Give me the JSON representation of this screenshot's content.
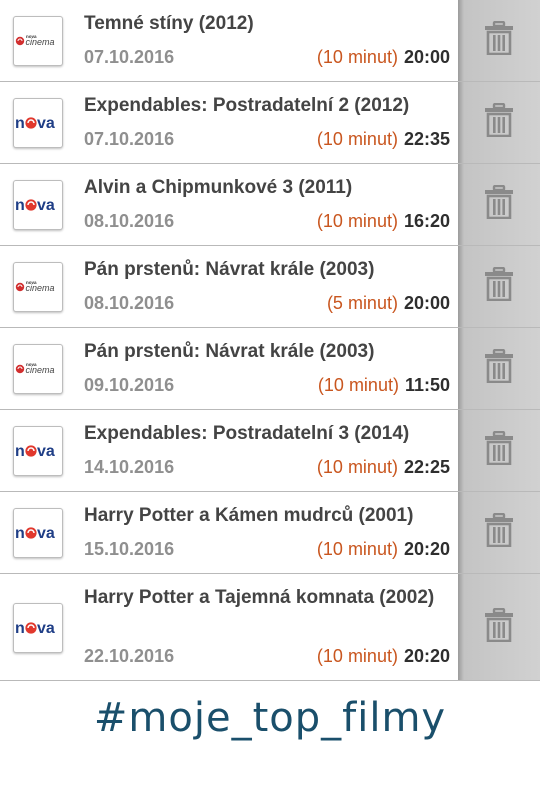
{
  "programs": [
    {
      "channel": "nova cinema",
      "title": "Temné stíny (2012)",
      "date": "07.10.2016",
      "reminder": "(10 minut)",
      "time": "20:00"
    },
    {
      "channel": "nova",
      "title": "Expendables: Postradatelní 2 (2012)",
      "date": "07.10.2016",
      "reminder": "(10 minut)",
      "time": "22:35"
    },
    {
      "channel": "nova",
      "title": "Alvin a Chipmunkové 3 (2011)",
      "date": "08.10.2016",
      "reminder": "(10 minut)",
      "time": "16:20"
    },
    {
      "channel": "nova cinema",
      "title": "Pán prstenů: Návrat krále (2003)",
      "date": "08.10.2016",
      "reminder": "(5 minut)",
      "time": "20:00"
    },
    {
      "channel": "nova cinema",
      "title": "Pán prstenů: Návrat krále (2003)",
      "date": "09.10.2016",
      "reminder": "(10 minut)",
      "time": "11:50"
    },
    {
      "channel": "nova",
      "title": "Expendables: Postradatelní 3 (2014)",
      "date": "14.10.2016",
      "reminder": "(10 minut)",
      "time": "22:25"
    },
    {
      "channel": "nova",
      "title": "Harry Potter a Kámen mudrců (2001)",
      "date": "15.10.2016",
      "reminder": "(10 minut)",
      "time": "20:20"
    },
    {
      "channel": "nova",
      "title": "Harry Potter a Tajemná komnata (2002)",
      "date": "22.10.2016",
      "reminder": "(10 minut)",
      "time": "20:20"
    }
  ],
  "hashtag": "#moje_top_filmy",
  "colors": {
    "title": "#444444",
    "date": "#8f8f8f",
    "reminder": "#c9561f",
    "time": "#2e2e2e",
    "delete_bg": "#d1d1d1",
    "hashtag": "#1a4f6b"
  },
  "icons": {
    "delete": "trash-icon",
    "channel_nova": "nova-logo",
    "channel_nova_cinema": "nova-cinema-logo"
  }
}
